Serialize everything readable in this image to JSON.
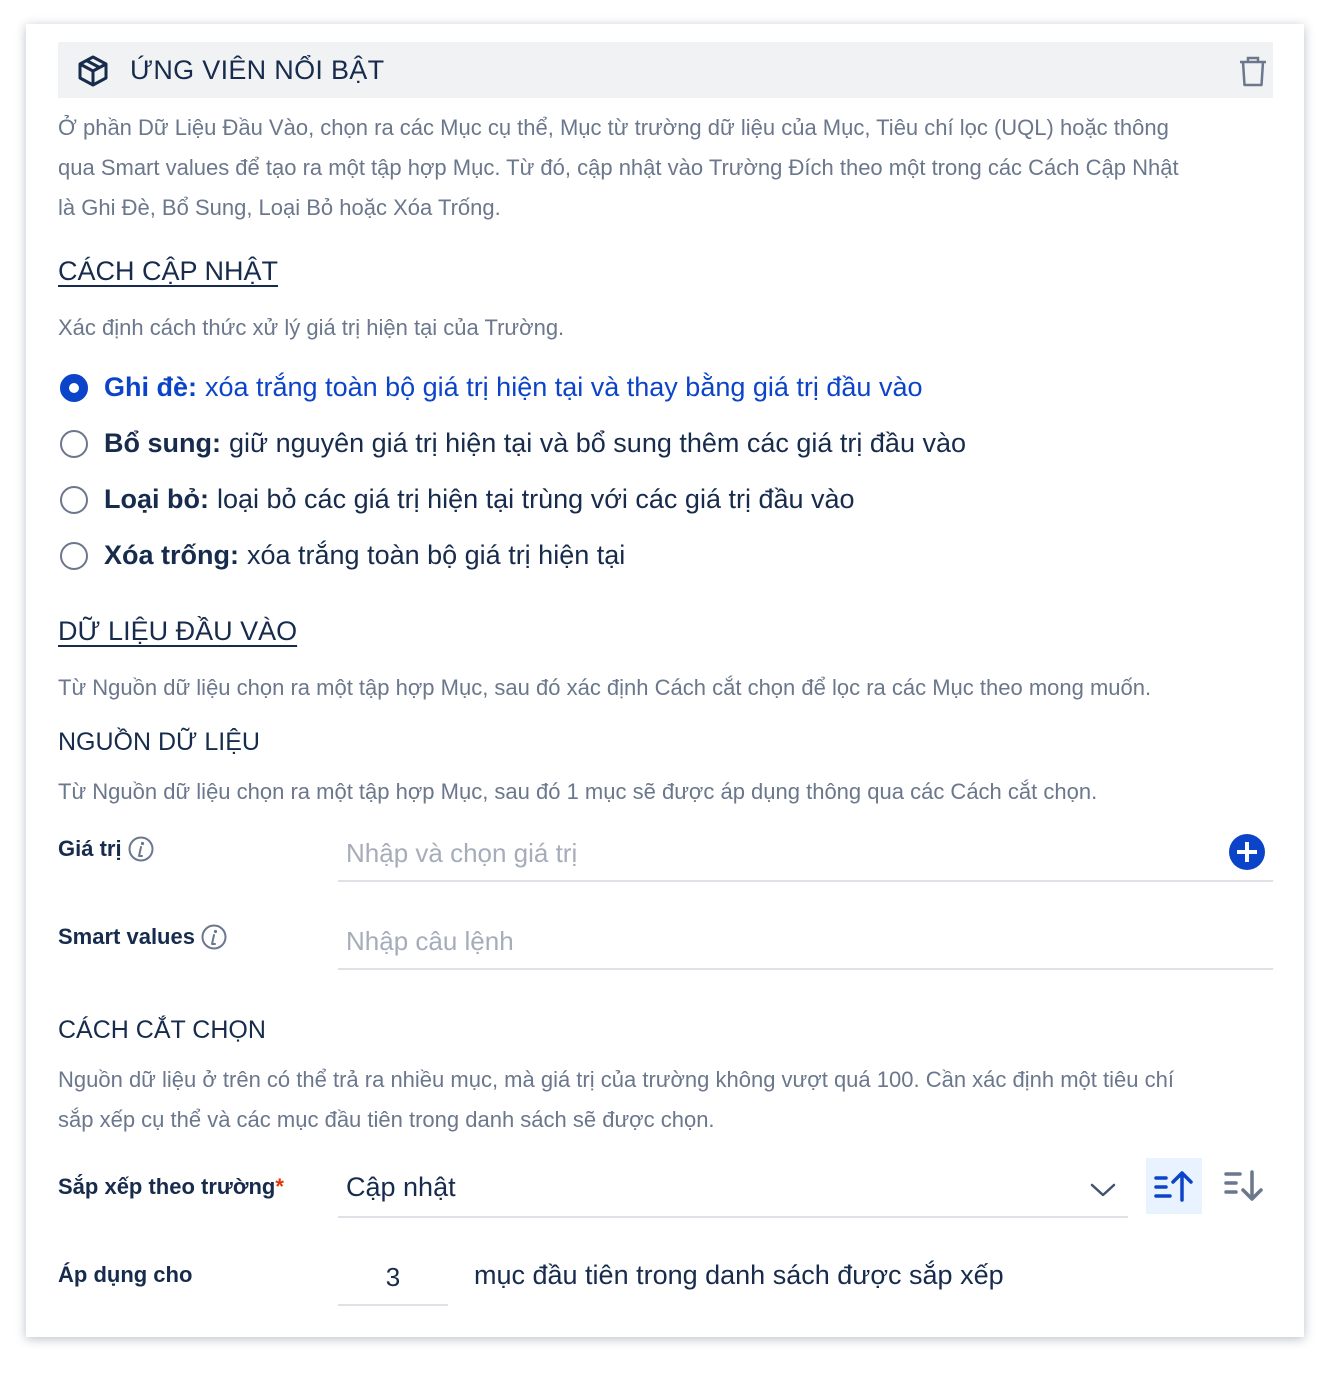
{
  "header": {
    "title": "ỨNG VIÊN NỔI BẬT",
    "icon": "box-icon",
    "delete_icon": "trash-icon"
  },
  "intro": {
    "line1": "Ở phần Dữ Liệu Đầu Vào, chọn ra các Mục cụ thể, Mục từ trường dữ liệu của Mục, Tiêu chí lọc (UQL) hoặc thông",
    "line2": "qua Smart values để tạo ra một tập hợp Mục. Từ đó, cập nhật vào Trường Đích theo một trong các Cách Cập Nhật",
    "line3": "là Ghi Đè, Bổ Sung, Loại Bỏ hoặc Xóa Trống."
  },
  "update_mode": {
    "title": "CÁCH CẬP NHẬT",
    "description": "Xác định cách thức xử lý giá trị hiện tại của Trường.",
    "options": [
      {
        "label": "Ghi đè:",
        "text": "xóa trắng toàn bộ giá trị hiện tại và thay bằng giá trị đầu vào",
        "selected": true
      },
      {
        "label": "Bổ sung:",
        "text": "giữ nguyên giá trị hiện tại và bổ sung thêm các giá trị đầu vào",
        "selected": false
      },
      {
        "label": "Loại bỏ:",
        "text": "loại bỏ các giá trị hiện tại trùng với các giá trị đầu vào",
        "selected": false
      },
      {
        "label": "Xóa trống:",
        "text": "xóa trắng toàn bộ giá trị hiện tại",
        "selected": false
      }
    ]
  },
  "input_data": {
    "title": "DỮ LIỆU ĐẦU VÀO",
    "description": "Từ Nguồn dữ liệu chọn ra một tập hợp Mục, sau đó xác định Cách cắt chọn để lọc ra các Mục theo mong muốn."
  },
  "source": {
    "title": "NGUỒN DỮ LIỆU",
    "description": "Từ Nguồn dữ liệu chọn ra một tập hợp Mục, sau đó 1 mục sẽ được áp dụng thông qua các Cách cắt chọn.",
    "value_label": "Giá trị",
    "value_placeholder": "Nhập và chọn giá trị",
    "smart_label": "Smart values",
    "smart_placeholder": "Nhập câu lệnh"
  },
  "cut": {
    "title": "CÁCH CẮT CHỌN",
    "line1": "Nguồn dữ liệu ở trên có thể trả ra nhiều mục, mà giá trị của trường không vượt quá 100. Cần xác định một tiêu chí",
    "line2": "sắp xếp cụ thể và các mục đầu tiên trong danh sách sẽ được chọn.",
    "sort_label": "Sắp xếp theo trường",
    "required_mark": "*",
    "sort_value": "Cập nhật",
    "sort_direction": "ascending",
    "apply_label": "Áp dụng cho",
    "apply_value": "3",
    "apply_suffix": "mục đầu tiên trong danh sách được sắp xếp"
  },
  "colors": {
    "accent": "#0c44c9",
    "text": "#172b4d",
    "muted": "#6b778c",
    "required": "#de350b"
  }
}
